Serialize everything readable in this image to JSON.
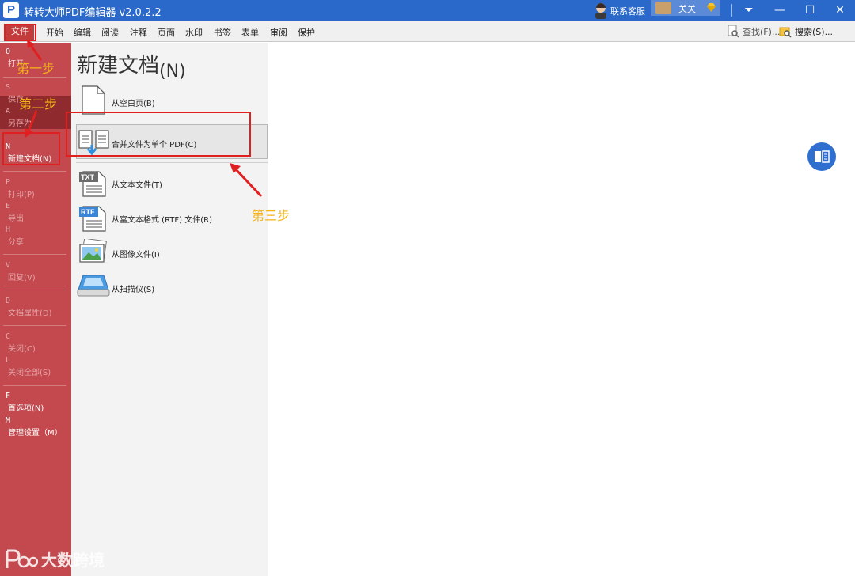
{
  "window": {
    "title": "转转大师PDF编辑器 v2.0.2.2",
    "logo_letter": "P",
    "customer_service": "联系客服",
    "user_name": "关关",
    "controls": {
      "dropdown": "⏷",
      "minimize": "—",
      "maximize": "☐",
      "close": "✕"
    }
  },
  "menubar": {
    "file": "文件",
    "items": [
      "开始",
      "编辑",
      "阅读",
      "注释",
      "页面",
      "水印",
      "书签",
      "表单",
      "审阅",
      "保护"
    ],
    "find": "查找(F)...",
    "search": "搜索(S)..."
  },
  "sidebar": {
    "items": [
      {
        "key": "O",
        "label": "打开"
      },
      {
        "key": "S",
        "label": "保存"
      },
      {
        "key": "A",
        "label": "另存为"
      },
      {
        "key": "N",
        "label": "新建文档(N)"
      },
      {
        "key": "P",
        "label": "打印(P)"
      },
      {
        "key": "E",
        "label": "导出"
      },
      {
        "key": "H",
        "label": "分享"
      },
      {
        "key": "V",
        "label": "回复(V)"
      },
      {
        "key": "D",
        "label": "文档属性(D)"
      },
      {
        "key": "C",
        "label": "关闭(C)"
      },
      {
        "key": "L",
        "label": "关闭全部(S)"
      },
      {
        "key": "F",
        "label": "首选项(N)"
      },
      {
        "key": "M",
        "label": "管理设置（M）"
      }
    ]
  },
  "panel": {
    "title": "新建文档",
    "title_key": "(N)",
    "options": [
      {
        "label": "从空白页(B)",
        "icon": "blank-page-icon"
      },
      {
        "label": "合并文件为单个 PDF(C)",
        "icon": "merge-files-icon"
      },
      {
        "label": "从文本文件(T)",
        "icon": "txt-file-icon",
        "badge": "TXT"
      },
      {
        "label": "从富文本格式 (RTF) 文件(R)",
        "icon": "rtf-file-icon",
        "badge": "RTF"
      },
      {
        "label": "从图像文件(I)",
        "icon": "image-file-icon"
      },
      {
        "label": "从扫描仪(S)",
        "icon": "scanner-icon"
      }
    ]
  },
  "annotations": {
    "step1": "第一步",
    "step2": "第二步",
    "step3": "第三步"
  },
  "watermark": {
    "text": "大数跨境"
  },
  "colors": {
    "titlebar": "#2a69c9",
    "sidebar": "#c3494e",
    "sidebar_selected": "#8f2a2e",
    "annotation_red": "#e02020",
    "annotation_text": "#f3b51a"
  }
}
